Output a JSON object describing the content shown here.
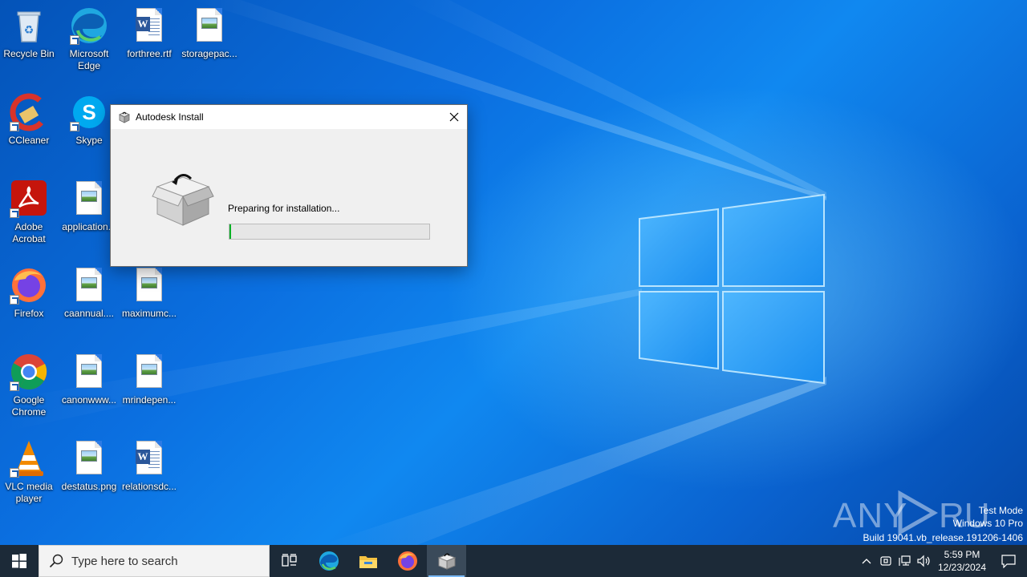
{
  "desktop": {
    "icons": [
      {
        "label": "Recycle Bin"
      },
      {
        "label": "Microsoft Edge"
      },
      {
        "label": "forthree.rtf"
      },
      {
        "label": "storagepac..."
      },
      {
        "label": "CCleaner"
      },
      {
        "label": "Skype"
      },
      {
        "label": "Adobe Acrobat"
      },
      {
        "label": "application..."
      },
      {
        "label": "Firefox"
      },
      {
        "label": "caannual...."
      },
      {
        "label": "maximumc..."
      },
      {
        "label": "Google Chrome"
      },
      {
        "label": "canonwww..."
      },
      {
        "label": "mrindepen..."
      },
      {
        "label": "VLC media player"
      },
      {
        "label": "destatus.png"
      },
      {
        "label": "relationsdc..."
      }
    ]
  },
  "dialog": {
    "title": "Autodesk Install",
    "status": "Preparing for installation...",
    "progress_fraction": 0.0
  },
  "watermark": {
    "brand": "ANY RUN",
    "mode": "Test Mode",
    "edition": "Windows 10 Pro",
    "build": "Build 19041.vb_release.191206-1406"
  },
  "taskbar": {
    "search_placeholder": "Type here to search",
    "apps": [
      "task-view",
      "microsoft-edge",
      "file-explorer",
      "firefox",
      "autodesk-install"
    ],
    "active_app": "autodesk-install",
    "clock_time": "5:59 PM",
    "clock_date": "12/23/2024"
  },
  "colors": {
    "taskbar": "#1c2a38",
    "progress_fill": "#06b025",
    "wallpaper": "#0a6fd8"
  }
}
